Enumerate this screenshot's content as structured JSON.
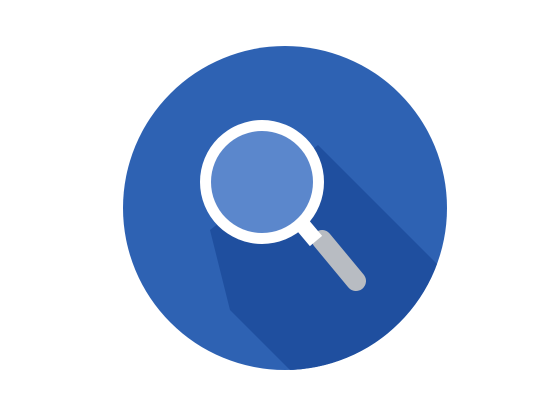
{
  "icon": {
    "name": "search-icon",
    "shape": "circle",
    "colors": {
      "background": "#ffffff",
      "circle": "#2e62b3",
      "long_shadow": "#1f4f9f",
      "lens_ring": "#ffffff",
      "lens_glass": "#5b87cc",
      "handle": "#b8bcc2",
      "handle_neck": "#ffffff"
    }
  }
}
